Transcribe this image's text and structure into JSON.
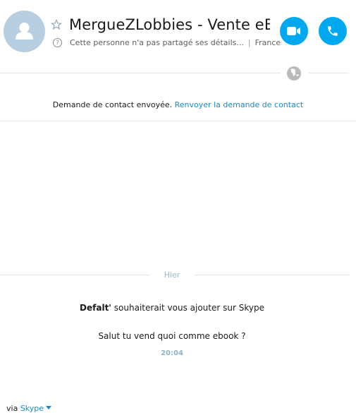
{
  "header": {
    "contact_name": "MergueZLobbies - Vente eB...",
    "status": "Cette personne n'a pas partagé ses détails...",
    "separator": "|",
    "location": "France",
    "help_glyph": "?"
  },
  "notice": {
    "text": "Demande de contact envoyée. ",
    "link": "Renvoyer la demande de contact"
  },
  "conversation": {
    "day_label": "Hier",
    "message": {
      "sender": "Defalt'",
      "request_text": " souhaiterait vous ajouter sur Skype",
      "body": "Salut tu vend quoi comme ebook ?",
      "time": "20:04"
    }
  },
  "footer": {
    "via_label": "via ",
    "channel": "Skype"
  },
  "colors": {
    "accent": "#00a8f0",
    "link": "#1a8ac4",
    "avatar_bg": "#b7cfe0"
  },
  "icons": [
    "avatar-placeholder-icon",
    "star-icon",
    "help-icon",
    "video-camera-icon",
    "phone-icon",
    "globe-icon",
    "chevron-down-icon"
  ]
}
